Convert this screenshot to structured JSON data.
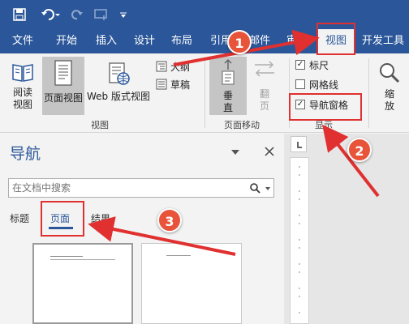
{
  "quick_access": {
    "icons": [
      "save-icon",
      "undo-icon",
      "redo-icon",
      "touch-mode-icon",
      "customize-qat-icon"
    ]
  },
  "tabs": [
    {
      "label": "文件"
    },
    {
      "label": "开始"
    },
    {
      "label": "插入"
    },
    {
      "label": "设计"
    },
    {
      "label": "布局"
    },
    {
      "label": "引用"
    },
    {
      "label": "邮件"
    },
    {
      "label": "审阅"
    },
    {
      "label": "视图"
    },
    {
      "label": "开发工具"
    }
  ],
  "ribbon": {
    "views_group": {
      "label": "视图",
      "read_mode": "阅读视图",
      "print_layout": "页面视图",
      "web_layout": "Web 版式视图",
      "outline": "大纲",
      "draft": "草稿"
    },
    "page_movement_group": {
      "label": "页面移动",
      "vertical": "垂直",
      "side_to_side": "翻页"
    },
    "show_group": {
      "label": "显示",
      "ruler": "标尺",
      "gridlines": "网格线",
      "nav_pane": "导航窗格"
    },
    "zoom_group": {
      "zoom": "缩放"
    }
  },
  "nav_pane": {
    "title": "导航",
    "search_placeholder": "在文档中搜索",
    "tabs": [
      "标题",
      "页面",
      "结果"
    ]
  },
  "annotations": {
    "badges": [
      "1",
      "2",
      "3"
    ],
    "color": "#e03030"
  }
}
